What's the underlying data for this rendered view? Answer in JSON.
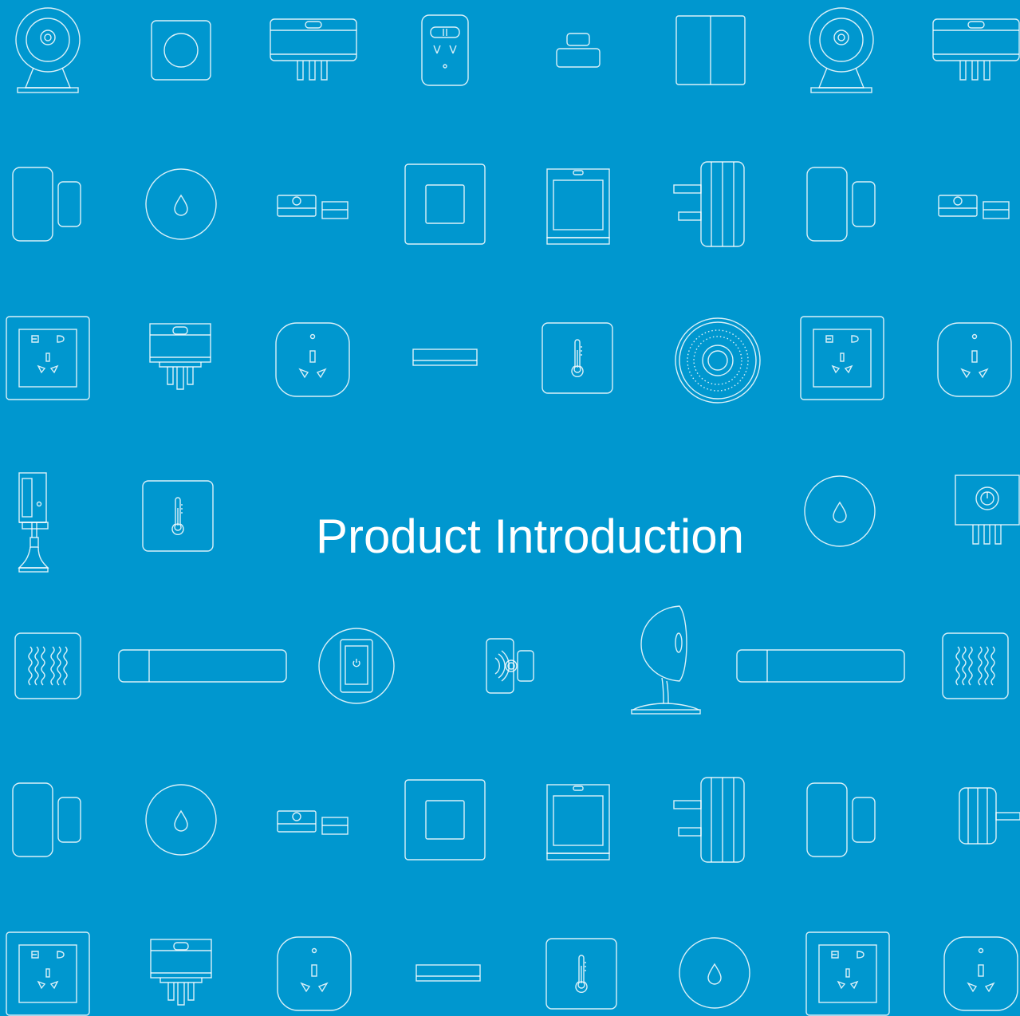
{
  "cover": {
    "title": "Product Introduction",
    "background_color": "#0097cf",
    "icon_color": "#ffffff"
  },
  "icons": [
    "camera-icon",
    "switch-single-icon",
    "plug-adapter-icon",
    "socket-icon",
    "motion-sensor-icon",
    "switch-double-icon",
    "camera-icon",
    "plug-adapter-icon",
    "door-sensor-icon",
    "water-sensor-icon",
    "vibration-sensor-icon",
    "wall-switch-icon",
    "curtain-panel-icon",
    "wall-plug-icon",
    "door-sensor-icon",
    "vibration-sensor-icon",
    "wall-outlet-icon",
    "plug-adapter-icon",
    "smart-plug-icon",
    "strip-sensor-icon",
    "temperature-sensor-icon",
    "gateway-hub-icon",
    "wall-outlet-icon",
    "smart-plug-icon",
    "mounted-camera-icon",
    "temperature-sensor-icon",
    "water-sensor-icon",
    "power-plug-icon",
    "heater-panel-icon",
    "light-bar-icon",
    "touch-switch-icon",
    "signal-sensor-icon",
    "dome-camera-icon",
    "light-bar-icon",
    "heater-panel-icon",
    "door-sensor-icon",
    "water-sensor-icon",
    "vibration-sensor-icon",
    "wall-switch-icon",
    "curtain-panel-icon",
    "wall-plug-icon",
    "door-sensor-icon",
    "side-plug-icon",
    "wall-outlet-icon",
    "plug-adapter-icon",
    "smart-plug-icon",
    "strip-sensor-icon",
    "temperature-sensor-icon",
    "water-sensor-icon",
    "wall-outlet-icon",
    "smart-plug-icon"
  ]
}
